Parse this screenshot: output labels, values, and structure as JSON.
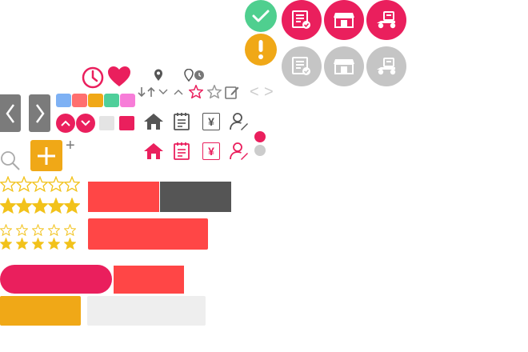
{
  "colors": {
    "pink": "#ea1f5d",
    "green": "#4fcf8f",
    "amber": "#f0a817",
    "gray_circle": "#c5c5c5",
    "gray_dark": "#555555",
    "gray_nav": "#7b7b7b",
    "red": "#ff4646",
    "light_gray": "#eeeeee",
    "star_yellow": "#f2c21a",
    "icon_gray": "#555555"
  },
  "swatches": [
    "#7eb1f4",
    "#ff6f6f",
    "#f0a817",
    "#4fcf9a",
    "#f77dd8"
  ],
  "status_circles": {
    "active": [
      "list-check-icon",
      "store-icon",
      "scooter-icon"
    ],
    "inactive": [
      "list-check-icon",
      "store-icon",
      "scooter-icon"
    ]
  },
  "indicators": [
    "check-icon",
    "exclamation-icon"
  ],
  "ratings": [
    {
      "style": "outline",
      "count": 5
    },
    {
      "style": "filled",
      "count": 5
    },
    {
      "style": "outline",
      "count": 5
    },
    {
      "style": "filled",
      "count": 5
    }
  ],
  "tab_icons": [
    "home-icon",
    "notebook-icon",
    "yen-icon",
    "user-edit-icon"
  ],
  "currency_symbol": "¥",
  "add_symbol": "+",
  "plus_symbol": "+",
  "arrows": {
    "left": "<",
    "right": ">"
  }
}
